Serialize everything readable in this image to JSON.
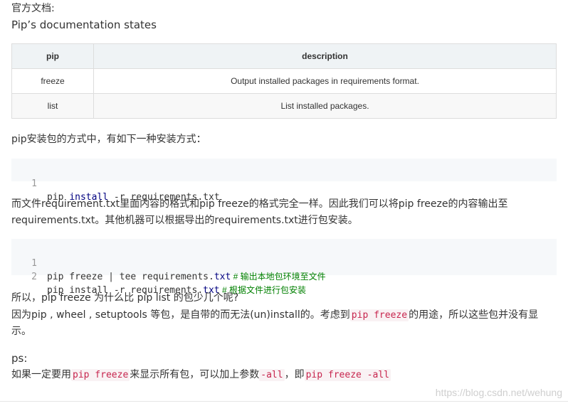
{
  "intro": {
    "label_cn": "官方文档:",
    "label_en": "Pip’s documentation states"
  },
  "table": {
    "headers": [
      "pip",
      "description"
    ],
    "rows": [
      [
        "freeze",
        "Output installed packages in requirements format."
      ],
      [
        "list",
        "List installed packages."
      ]
    ]
  },
  "para1": "pip安装包的方式中，有如下一种安装方式：",
  "code1": {
    "line_no": "1",
    "tokens": [
      "pip ",
      "install",
      " -r requirements.txt"
    ]
  },
  "para2": {
    "line1": "而文件requirement.txt里面内容的格式和pip freeze的格式完全一样。因此我们可以将pip freeze的内容输出至",
    "line2": "requirements.txt。其他机器可以根据导出的requirements.txt进行包安装。"
  },
  "code2": {
    "lines": [
      {
        "no": "1",
        "code_a": "pip freeze | tee requirements.",
        "code_kw": "txt",
        "comment": " # 输出本地包环境至文件"
      },
      {
        "no": "2",
        "code_a": "pip install -r requirements.",
        "code_kw": "txt",
        "comment": " # 根据文件进行包安装"
      }
    ]
  },
  "para3": {
    "q": "所以，pip freeze 为什么比 pip list 的包少几个呢?",
    "a_pre": "因为pip , wheel , setuptools 等包，是自带的而无法(un)install的。考虑到",
    "a_code": "pip freeze",
    "a_post": "的用途，所以这些包并没有显",
    "a_line2": "示。"
  },
  "ps": {
    "label": "ps:",
    "pre": "如果一定要用",
    "code1": "pip freeze",
    "mid1": "来显示所有包，可以加上参数",
    "code2": "-all",
    "mid2": "，即",
    "code3": "pip freeze -all"
  },
  "watermark": "https://blog.csdn.net/wehung"
}
